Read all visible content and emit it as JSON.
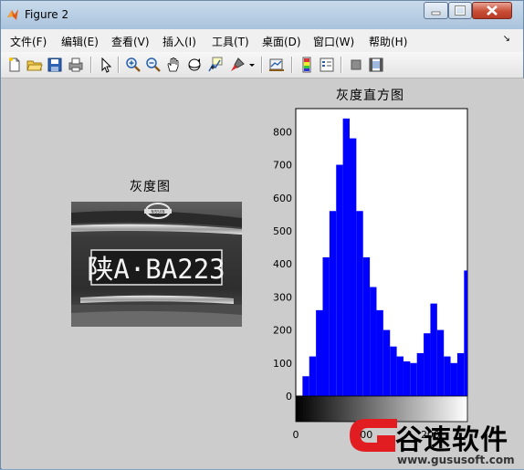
{
  "window": {
    "title": "Figure 2"
  },
  "menu": {
    "items": [
      "文件(F)",
      "编辑(E)",
      "查看(V)",
      "插入(I)",
      "工具(T)",
      "桌面(D)",
      "窗口(W)",
      "帮助(H)"
    ],
    "overflow": "↘"
  },
  "toolbar": {
    "icons": [
      "new-figure-icon",
      "open-file-icon",
      "save-icon",
      "print-icon",
      "edit-plot-icon",
      "zoom-in-icon",
      "zoom-out-icon",
      "pan-icon",
      "rotate-3d-icon",
      "data-cursor-icon",
      "brush-icon",
      "brush-dropdown-icon",
      "link-plot-icon",
      "insert-colorbar-icon",
      "insert-legend-icon",
      "hide-plot-tools-icon",
      "show-plot-tools-icon"
    ]
  },
  "left_axes": {
    "title": "灰度图",
    "plate_text": "陕A·BA223",
    "logo_text": "NISSAN"
  },
  "chart_data": {
    "type": "bar",
    "title": "灰度直方图",
    "xlabel": "",
    "ylabel": "",
    "xlim": [
      0,
      255
    ],
    "ylim": [
      0,
      850
    ],
    "yticks": [
      0,
      100,
      200,
      300,
      400,
      500,
      600,
      700,
      800
    ],
    "xticks": [
      0,
      100,
      200
    ],
    "xtick_labels": [
      "0",
      "100",
      "200"
    ],
    "series_color": "#0000ff",
    "colorbar": "grayscale 0-255 under x axis",
    "bins": [
      0,
      10,
      20,
      30,
      40,
      50,
      60,
      70,
      80,
      90,
      100,
      110,
      120,
      130,
      140,
      150,
      160,
      170,
      180,
      190,
      200,
      210,
      220,
      230,
      240,
      250,
      255
    ],
    "values": [
      0,
      60,
      120,
      260,
      420,
      560,
      700,
      840,
      780,
      560,
      420,
      330,
      260,
      200,
      150,
      120,
      105,
      100,
      130,
      190,
      280,
      200,
      120,
      100,
      130,
      380,
      0
    ]
  },
  "watermark": {
    "brand": "谷速软件",
    "url": "www.gususoft.com",
    "accent": "#e11d22"
  }
}
